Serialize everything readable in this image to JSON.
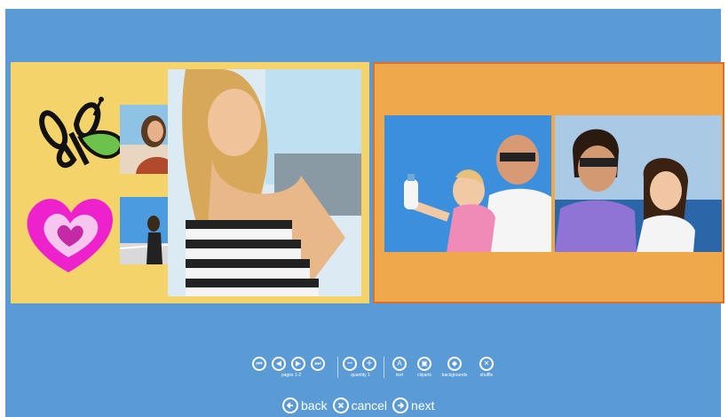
{
  "toolbar": {
    "pages_label": "pages 1-2",
    "quantity_label": "quantity 1",
    "text_label": "text",
    "cliparts_label": "cliparts",
    "backgrounds_label": "backgrounds",
    "shuffle_label": "shuffle"
  },
  "nav": {
    "back_label": "back",
    "cancel_label": "cancel",
    "next_label": "next"
  },
  "colors": {
    "background": "#5b9bd5",
    "left_page": "#f5d36b",
    "right_page": "#f0a94a",
    "right_page_border": "#d9712a",
    "heart": "#ee22cc"
  },
  "icons": {
    "first": "skip-first-icon",
    "prev": "prev-icon",
    "next": "next-icon",
    "last": "skip-last-icon",
    "minus": "minus-icon",
    "plus": "plus-icon",
    "text": "text-icon",
    "clipart": "clipart-icon",
    "backgrounds": "eraser-icon",
    "shuffle": "shuffle-icon"
  }
}
